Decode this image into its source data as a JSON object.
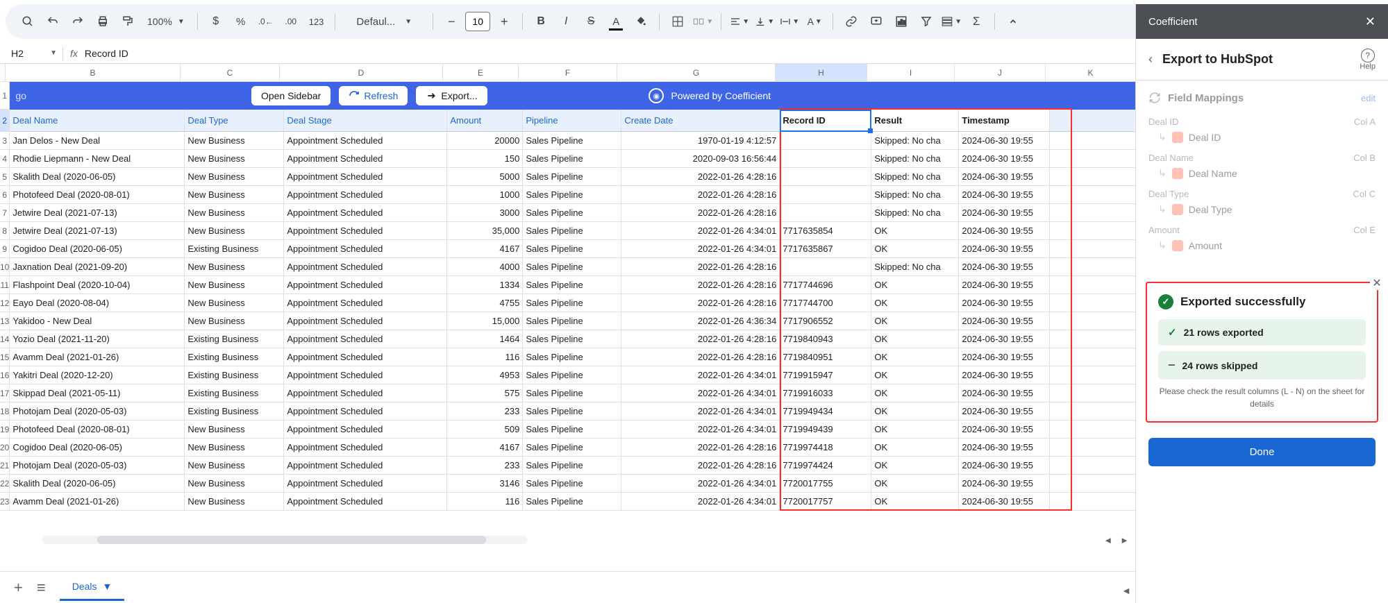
{
  "toolbar": {
    "zoom": "100%",
    "font": "Defaul...",
    "font_size": "10",
    "format_numbers": "123"
  },
  "formula_bar": {
    "cell_ref": "H2",
    "value": "Record ID"
  },
  "columns": [
    "B",
    "C",
    "D",
    "E",
    "F",
    "G",
    "H",
    "I",
    "J",
    "K"
  ],
  "selected_col": "H",
  "banner": {
    "open_sidebar": "Open Sidebar",
    "refresh": "Refresh",
    "export": "Export...",
    "powered": "Powered by Coefficient"
  },
  "headers": {
    "B": "Deal Name",
    "C": "Deal Type",
    "D": "Deal Stage",
    "E": "Amount",
    "F": "Pipeline",
    "G": "Create Date",
    "H": "Record ID",
    "I": "Result",
    "J": "Timestamp"
  },
  "rows": [
    {
      "n": 3,
      "B": "Jan Delos - New Deal",
      "C": "New Business",
      "D": "Appointment Scheduled",
      "E": "20000",
      "F": "Sales Pipeline",
      "G": "1970-01-19 4:12:57",
      "H": "",
      "I": "Skipped: No cha",
      "J": "2024-06-30 19:55"
    },
    {
      "n": 4,
      "B": "Rhodie Liepmann - New Deal",
      "C": "New Business",
      "D": "Appointment Scheduled",
      "E": "150",
      "F": "Sales Pipeline",
      "G": "2020-09-03 16:56:44",
      "H": "",
      "I": "Skipped: No cha",
      "J": "2024-06-30 19:55"
    },
    {
      "n": 5,
      "B": "Skalith Deal (2020-06-05)",
      "C": "New Business",
      "D": "Appointment Scheduled",
      "E": "5000",
      "F": "Sales Pipeline",
      "G": "2022-01-26 4:28:16",
      "H": "",
      "I": "Skipped: No cha",
      "J": "2024-06-30 19:55"
    },
    {
      "n": 6,
      "B": "Photofeed Deal (2020-08-01)",
      "C": "New Business",
      "D": "Appointment Scheduled",
      "E": "1000",
      "F": "Sales Pipeline",
      "G": "2022-01-26 4:28:16",
      "H": "",
      "I": "Skipped: No cha",
      "J": "2024-06-30 19:55"
    },
    {
      "n": 7,
      "B": "Jetwire Deal (2021-07-13)",
      "C": "New Business",
      "D": "Appointment Scheduled",
      "E": "3000",
      "F": "Sales Pipeline",
      "G": "2022-01-26 4:28:16",
      "H": "",
      "I": "Skipped: No cha",
      "J": "2024-06-30 19:55"
    },
    {
      "n": 8,
      "B": "Jetwire Deal (2021-07-13)",
      "C": "New Business",
      "D": "Appointment Scheduled",
      "E": "35,000",
      "F": "Sales Pipeline",
      "G": "2022-01-26 4:34:01",
      "H": "7717635854",
      "I": "OK",
      "J": "2024-06-30 19:55"
    },
    {
      "n": 9,
      "B": "Cogidoo Deal (2020-06-05)",
      "C": "Existing Business",
      "D": "Appointment Scheduled",
      "E": "4167",
      "F": "Sales Pipeline",
      "G": "2022-01-26 4:34:01",
      "H": "7717635867",
      "I": "OK",
      "J": "2024-06-30 19:55"
    },
    {
      "n": 10,
      "B": "Jaxnation Deal (2021-09-20)",
      "C": "New Business",
      "D": "Appointment Scheduled",
      "E": "4000",
      "F": "Sales Pipeline",
      "G": "2022-01-26 4:28:16",
      "H": "",
      "I": "Skipped: No cha",
      "J": "2024-06-30 19:55"
    },
    {
      "n": 11,
      "B": "Flashpoint Deal (2020-10-04)",
      "C": "New Business",
      "D": "Appointment Scheduled",
      "E": "1334",
      "F": "Sales Pipeline",
      "G": "2022-01-26 4:28:16",
      "H": "7717744696",
      "I": "OK",
      "J": "2024-06-30 19:55"
    },
    {
      "n": 12,
      "B": "Eayo Deal (2020-08-04)",
      "C": "New Business",
      "D": "Appointment Scheduled",
      "E": "4755",
      "F": "Sales Pipeline",
      "G": "2022-01-26 4:28:16",
      "H": "7717744700",
      "I": "OK",
      "J": "2024-06-30 19:55"
    },
    {
      "n": 13,
      "B": "Yakidoo - New Deal",
      "C": "New Business",
      "D": "Appointment Scheduled",
      "E": "15,000",
      "F": "Sales Pipeline",
      "G": "2022-01-26 4:36:34",
      "H": "7717906552",
      "I": "OK",
      "J": "2024-06-30 19:55"
    },
    {
      "n": 14,
      "B": "Yozio Deal (2021-11-20)",
      "C": "Existing Business",
      "D": "Appointment Scheduled",
      "E": "1464",
      "F": "Sales Pipeline",
      "G": "2022-01-26 4:28:16",
      "H": "7719840943",
      "I": "OK",
      "J": "2024-06-30 19:55"
    },
    {
      "n": 15,
      "B": "Avamm Deal (2021-01-26)",
      "C": "Existing Business",
      "D": "Appointment Scheduled",
      "E": "116",
      "F": "Sales Pipeline",
      "G": "2022-01-26 4:28:16",
      "H": "7719840951",
      "I": "OK",
      "J": "2024-06-30 19:55"
    },
    {
      "n": 16,
      "B": "Yakitri Deal (2020-12-20)",
      "C": "Existing Business",
      "D": "Appointment Scheduled",
      "E": "4953",
      "F": "Sales Pipeline",
      "G": "2022-01-26 4:34:01",
      "H": "7719915947",
      "I": "OK",
      "J": "2024-06-30 19:55"
    },
    {
      "n": 17,
      "B": "Skippad Deal (2021-05-11)",
      "C": "Existing Business",
      "D": "Appointment Scheduled",
      "E": "575",
      "F": "Sales Pipeline",
      "G": "2022-01-26 4:34:01",
      "H": "7719916033",
      "I": "OK",
      "J": "2024-06-30 19:55"
    },
    {
      "n": 18,
      "B": "Photojam Deal (2020-05-03)",
      "C": "Existing Business",
      "D": "Appointment Scheduled",
      "E": "233",
      "F": "Sales Pipeline",
      "G": "2022-01-26 4:34:01",
      "H": "7719949434",
      "I": "OK",
      "J": "2024-06-30 19:55"
    },
    {
      "n": 19,
      "B": "Photofeed Deal (2020-08-01)",
      "C": "New Business",
      "D": "Appointment Scheduled",
      "E": "509",
      "F": "Sales Pipeline",
      "G": "2022-01-26 4:34:01",
      "H": "7719949439",
      "I": "OK",
      "J": "2024-06-30 19:55"
    },
    {
      "n": 20,
      "B": "Cogidoo Deal (2020-06-05)",
      "C": "New Business",
      "D": "Appointment Scheduled",
      "E": "4167",
      "F": "Sales Pipeline",
      "G": "2022-01-26 4:28:16",
      "H": "7719974418",
      "I": "OK",
      "J": "2024-06-30 19:55"
    },
    {
      "n": 21,
      "B": "Photojam Deal (2020-05-03)",
      "C": "New Business",
      "D": "Appointment Scheduled",
      "E": "233",
      "F": "Sales Pipeline",
      "G": "2022-01-26 4:28:16",
      "H": "7719974424",
      "I": "OK",
      "J": "2024-06-30 19:55"
    },
    {
      "n": 22,
      "B": "Skalith Deal (2020-06-05)",
      "C": "New Business",
      "D": "Appointment Scheduled",
      "E": "3146",
      "F": "Sales Pipeline",
      "G": "2022-01-26 4:34:01",
      "H": "7720017755",
      "I": "OK",
      "J": "2024-06-30 19:55"
    },
    {
      "n": 23,
      "B": "Avamm Deal (2021-01-26)",
      "C": "New Business",
      "D": "Appointment Scheduled",
      "E": "116",
      "F": "Sales Pipeline",
      "G": "2022-01-26 4:34:01",
      "H": "7720017757",
      "I": "OK",
      "J": "2024-06-30 19:55"
    }
  ],
  "row1_frag": "go",
  "sheet_tab": "Deals",
  "sidebar": {
    "header": "Coefficient",
    "title": "Export to HubSpot",
    "help": "Help",
    "mappings": {
      "label": "Field Mappings",
      "edit": "edit",
      "items": [
        {
          "src": "Deal ID",
          "dst": "Deal ID",
          "col": "Col A"
        },
        {
          "src": "Deal Name",
          "dst": "Deal Name",
          "col": "Col B"
        },
        {
          "src": "Deal Type",
          "dst": "Deal Type",
          "col": "Col C"
        },
        {
          "src": "Amount",
          "dst": "Amount",
          "col": "Col E"
        }
      ]
    },
    "success": {
      "title": "Exported successfully",
      "exported": "21 rows exported",
      "skipped": "24 rows skipped",
      "note": "Please check the result columns (L - N) on the sheet for details"
    },
    "done": "Done"
  }
}
